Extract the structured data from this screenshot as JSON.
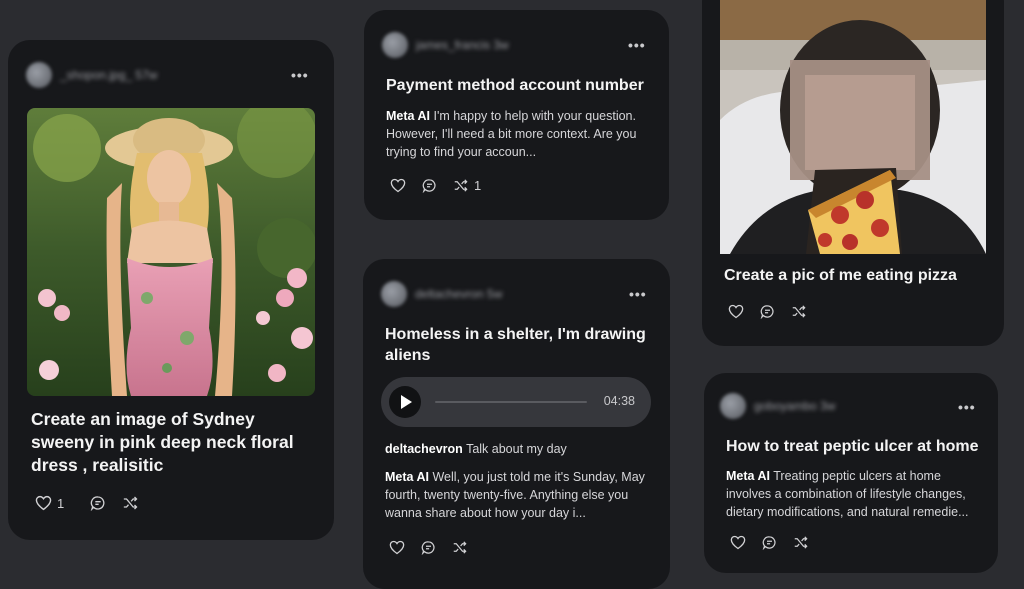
{
  "cards": [
    {
      "username": "_shopon.jpg_ 57w",
      "title": "Create an image of Sydney sweeny in pink deep neck floral dress , realisitic",
      "like_count": "1"
    },
    {
      "username": "james_francis 3w",
      "title": "Payment method account number",
      "response_label": "Meta AI",
      "response_text": "I'm happy to help with your question. However, I'll need a bit more context. Are you trying to find your accoun...",
      "share_count": "1"
    },
    {
      "username": "deltachevron 5w",
      "title": "Homeless in a shelter, I'm drawing aliens",
      "audio_duration": "04:38",
      "user_label": "deltachevron",
      "user_text": "Talk about my day",
      "response_label": "Meta AI",
      "response_text": "Well, you just told me it's Sunday, May fourth, twenty twenty-five. Anything else you wanna share about how your day i..."
    },
    {
      "title": "Create a pic of me eating pizza"
    },
    {
      "username": "goboyambo 3w",
      "title": "How to treat peptic ulcer at home",
      "response_label": "Meta AI",
      "response_text": "Treating peptic ulcers at home involves a combination of lifestyle changes, dietary modifications, and natural remedie..."
    }
  ],
  "icons": {
    "like": "heart-icon",
    "comment": "comment-icon",
    "remix": "shuffle-icon",
    "more": "more-icon",
    "play": "play-icon"
  },
  "colors": {
    "background": "#2b2c30",
    "card": "#17181b",
    "player": "#36373c"
  }
}
